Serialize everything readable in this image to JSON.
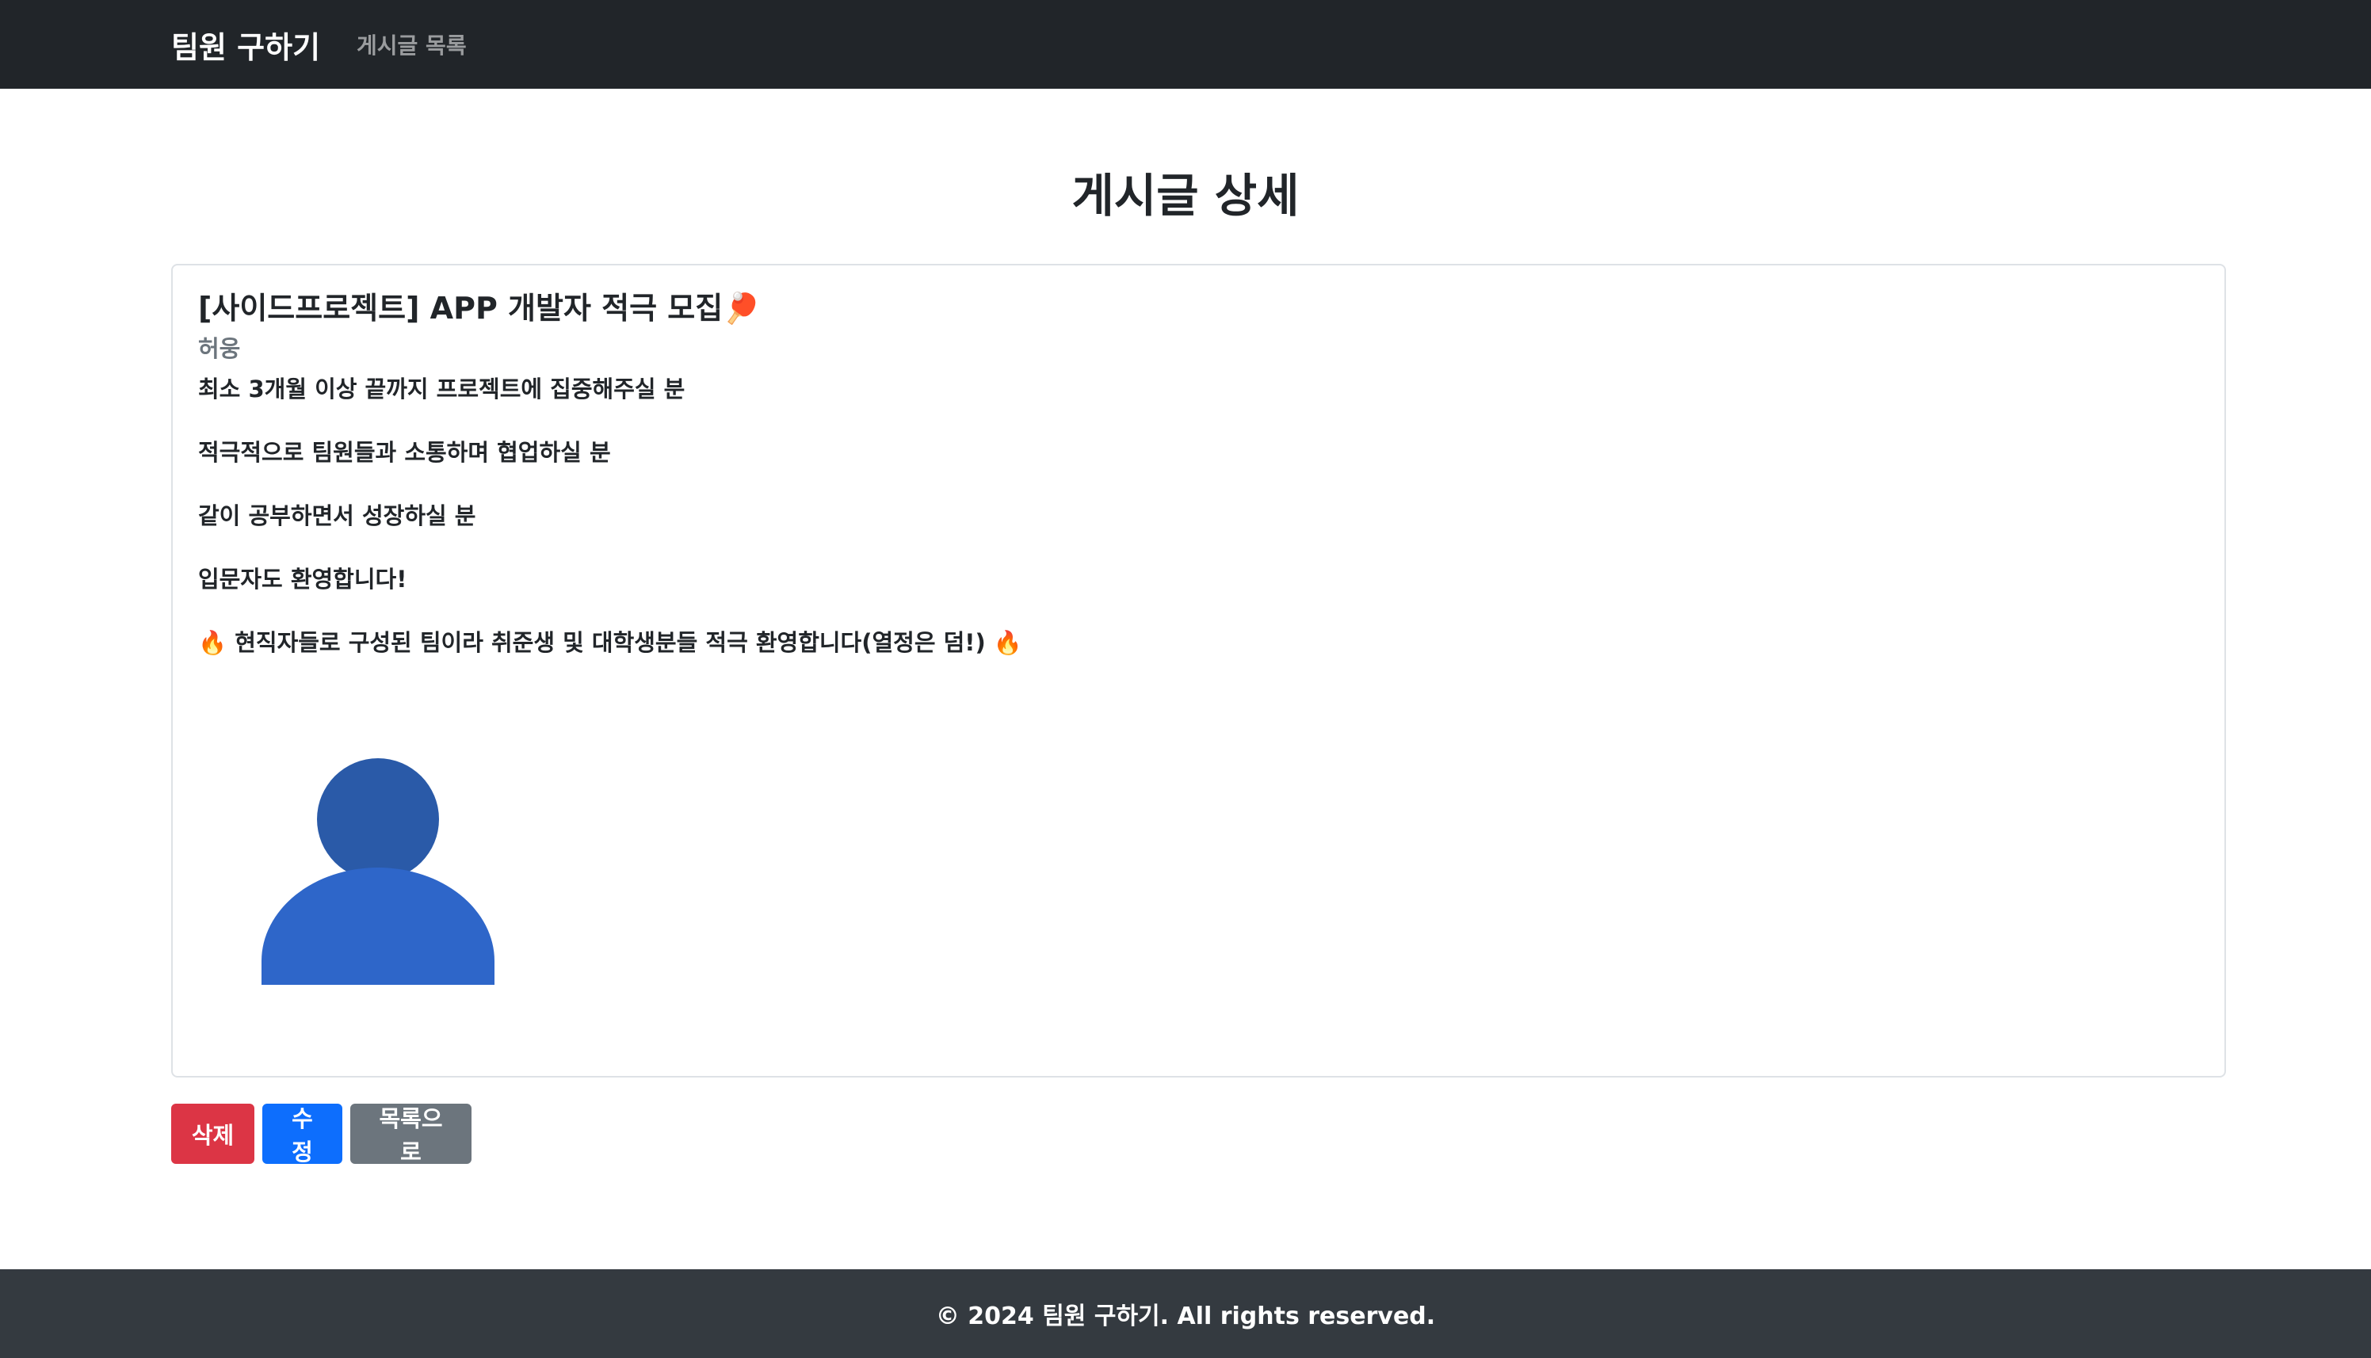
{
  "navbar": {
    "brand": "팀원 구하기",
    "links": [
      {
        "label": "게시글 목록"
      }
    ]
  },
  "page": {
    "title": "게시글 상세"
  },
  "post": {
    "title": "[사이드프로젝트] APP 개발자 적극 모집🏓",
    "author": "허웅",
    "body": [
      "최소 3개월 이상 끝까지 프로젝트에 집중해주실 분",
      "적극적으로 팀원들과 소통하며 협업하실 분",
      "같이 공부하면서 성장하실 분",
      "입문자도 환영합니다!",
      "🔥 현직자들로 구성된 팀이라 취준생 및 대학생분들 적극 환영합니다(열정은 덤!) 🔥"
    ],
    "image": {
      "icon": "user-avatar-icon",
      "head_color": "#2a5aa8",
      "body_color": "#2e66c9"
    }
  },
  "actions": {
    "delete_label": "삭제",
    "edit_label": "수정",
    "list_label": "목록으로"
  },
  "footer": {
    "text": "© 2024 팀원 구하기. All rights reserved."
  },
  "colors": {
    "navbar_bg": "#212529",
    "footer_bg": "#343a40",
    "danger": "#dc3545",
    "primary": "#0d6efd",
    "secondary": "#6c757d"
  }
}
